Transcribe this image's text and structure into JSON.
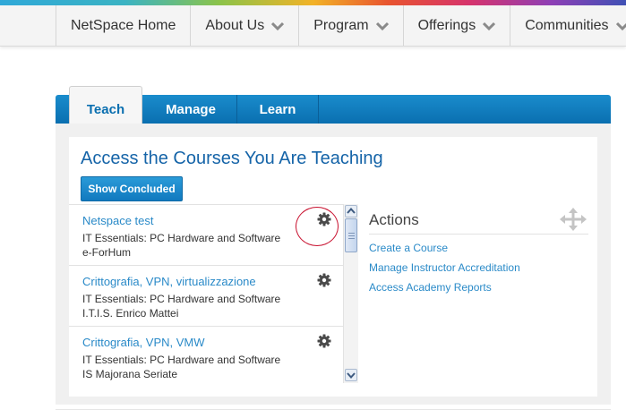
{
  "nav": {
    "items": [
      {
        "label": "NetSpace Home",
        "has_dropdown": false
      },
      {
        "label": "About Us",
        "has_dropdown": true
      },
      {
        "label": "Program",
        "has_dropdown": true
      },
      {
        "label": "Offerings",
        "has_dropdown": true
      },
      {
        "label": "Communities",
        "has_dropdown": true
      }
    ]
  },
  "tabs": [
    {
      "label": "Teach",
      "active": true
    },
    {
      "label": "Manage",
      "active": false
    },
    {
      "label": "Learn",
      "active": false
    }
  ],
  "main": {
    "heading": "Access the Courses You Are Teaching",
    "show_concluded_label": "Show Concluded"
  },
  "courses": [
    {
      "title": "Netspace test",
      "subtitle": "IT Essentials: PC Hardware and Software",
      "institution": "e-ForHum"
    },
    {
      "title": "Crittografia, VPN, virtualizzazione",
      "subtitle": "IT Essentials: PC Hardware and Software",
      "institution": "I.T.I.S. Enrico Mattei"
    },
    {
      "title": "Crittografia, VPN, VMW",
      "subtitle": "IT Essentials: PC Hardware and Software",
      "institution": "IS Majorana Seriate"
    }
  ],
  "actions": {
    "title": "Actions",
    "links": [
      "Create a Course",
      "Manage Instructor Accreditation",
      "Access Academy Reports"
    ]
  },
  "colors": {
    "accent": "#0a6fb0",
    "link": "#2a8ac8",
    "heading": "#1564a8",
    "highlight": "#c8102e"
  },
  "icons": {
    "course_settings": "gear-icon",
    "actions_move": "move-icon",
    "nav_dropdown": "chevron-down-icon"
  }
}
